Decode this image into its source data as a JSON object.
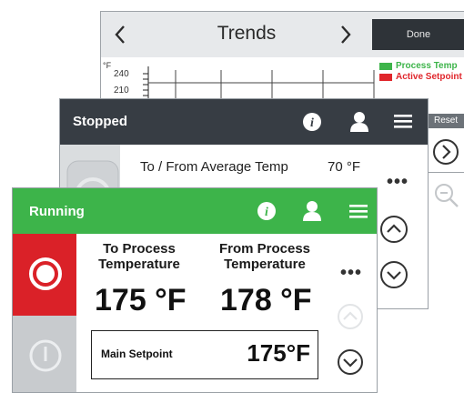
{
  "trends": {
    "title": "Trends",
    "prev_icon": "chevron-left-icon",
    "next_icon": "chevron-right-icon",
    "done_label": "Done",
    "unit": "°F",
    "y_ticks": [
      "240",
      "210"
    ],
    "legend": [
      {
        "label": "Process Temp",
        "color": "#3db44a"
      },
      {
        "label": "Active Setpoint",
        "color": "#e0262c"
      }
    ],
    "reset_label": "Reset"
  },
  "stopped": {
    "status": "Stopped",
    "header_color": "#373d44",
    "info_icon": "info-icon",
    "user_icon": "user-icon",
    "menu_icon": "menu-icon",
    "row_label": "To / From Average Temp",
    "row_value": "70 °F",
    "more_label": "•••"
  },
  "running": {
    "status": "Running",
    "header_color": "#3db44a",
    "info_icon": "info-icon",
    "user_icon": "user-icon",
    "menu_icon": "menu-icon",
    "stop_icon": "stop-icon",
    "start_icon": "power-icon",
    "to_process_label_1": "To Process",
    "to_process_label_2": "Temperature",
    "to_process_value": "175 °F",
    "from_process_label_1": "From Process",
    "from_process_label_2": "Temperature",
    "from_process_value": "178 °F",
    "setpoint_label": "Main Setpoint",
    "setpoint_value": "175°F",
    "more_label": "•••"
  }
}
